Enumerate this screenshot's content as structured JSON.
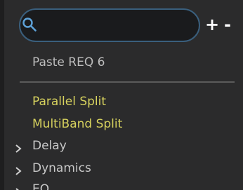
{
  "search": {
    "value": "",
    "placeholder": ""
  },
  "toolbar": {
    "add_label": "+",
    "remove_label": "-"
  },
  "menu": {
    "paste_label": "Paste REQ 6",
    "items": [
      {
        "label": "Parallel Split",
        "color": "#d7d25e",
        "expandable": false
      },
      {
        "label": "MultiBand Split",
        "color": "#d7d25e",
        "expandable": false
      },
      {
        "label": "Delay",
        "color": "#c9c9c9",
        "expandable": true
      },
      {
        "label": "Dynamics",
        "color": "#c9c9c9",
        "expandable": true
      },
      {
        "label": "EQ",
        "color": "#c9c9c9",
        "expandable": true
      }
    ]
  },
  "colors": {
    "background": "#2b2b2c",
    "search_border": "#3a5f7d",
    "search_icon": "#5ea3da",
    "highlight_text": "#d7d25e",
    "normal_text": "#c9c9c9"
  }
}
